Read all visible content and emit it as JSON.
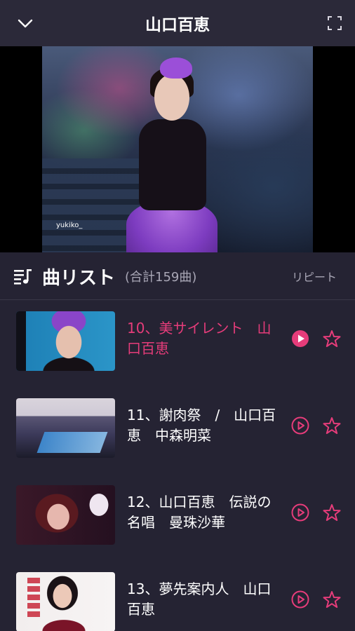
{
  "header": {
    "title": "山口百恵",
    "back_icon": "chevron-down-icon",
    "fullscreen_icon": "fullscreen-icon"
  },
  "video": {
    "watermark": "yukiko_"
  },
  "list": {
    "title": "曲リスト",
    "total": "(合計159曲)",
    "repeat_label": "リピート"
  },
  "tracks": [
    {
      "title": "10、美サイレント　山口百恵",
      "active": true
    },
    {
      "title": "11、謝肉祭　/　山口百恵　中森明菜",
      "active": false
    },
    {
      "title": "12、山口百恵　伝説の名唱　曼珠沙華",
      "active": false
    },
    {
      "title": "13、夢先案内人　山口百恵",
      "active": false
    }
  ],
  "colors": {
    "accent": "#e63c7a",
    "background": "#252333",
    "header_bg": "#2b2939",
    "secondary_text": "#a9a7b6"
  }
}
